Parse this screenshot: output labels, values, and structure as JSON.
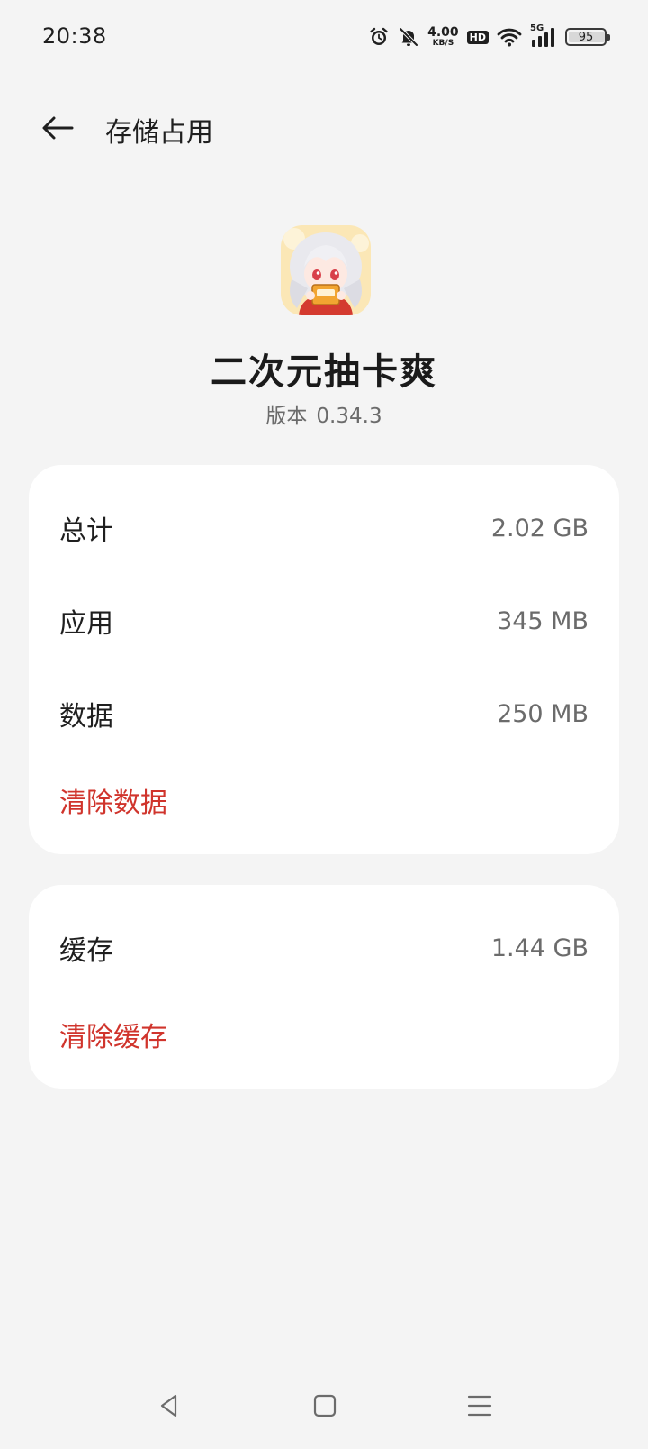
{
  "status_bar": {
    "time": "20:38",
    "net_speed_value": "4.00",
    "net_speed_unit": "KB/S",
    "hd_label": "HD",
    "network_type": "5G",
    "battery_level": "95",
    "icons": [
      "alarm-icon",
      "mute-bell-icon",
      "hd-icon",
      "wifi-icon",
      "signal-icon",
      "battery-icon"
    ]
  },
  "header": {
    "title": "存储占用",
    "back_icon": "arrow-left-icon"
  },
  "app": {
    "name": "二次元抽卡爽",
    "version_label": "版本",
    "version": "0.34.3"
  },
  "storage": {
    "total": {
      "label": "总计",
      "value": "2.02 GB"
    },
    "app": {
      "label": "应用",
      "value": "345 MB"
    },
    "data": {
      "label": "数据",
      "value": "250 MB"
    },
    "clear_data": "清除数据"
  },
  "cache": {
    "label": "缓存",
    "value": "1.44 GB",
    "clear_cache": "清除缓存"
  },
  "nav_bar": {
    "icons": [
      "triangle-back-icon",
      "square-home-icon",
      "menu-recents-icon"
    ]
  },
  "colors": {
    "background": "#f4f4f4",
    "card": "#ffffff",
    "accent_red": "#d0342c",
    "secondary_text": "#6b6b6b"
  }
}
